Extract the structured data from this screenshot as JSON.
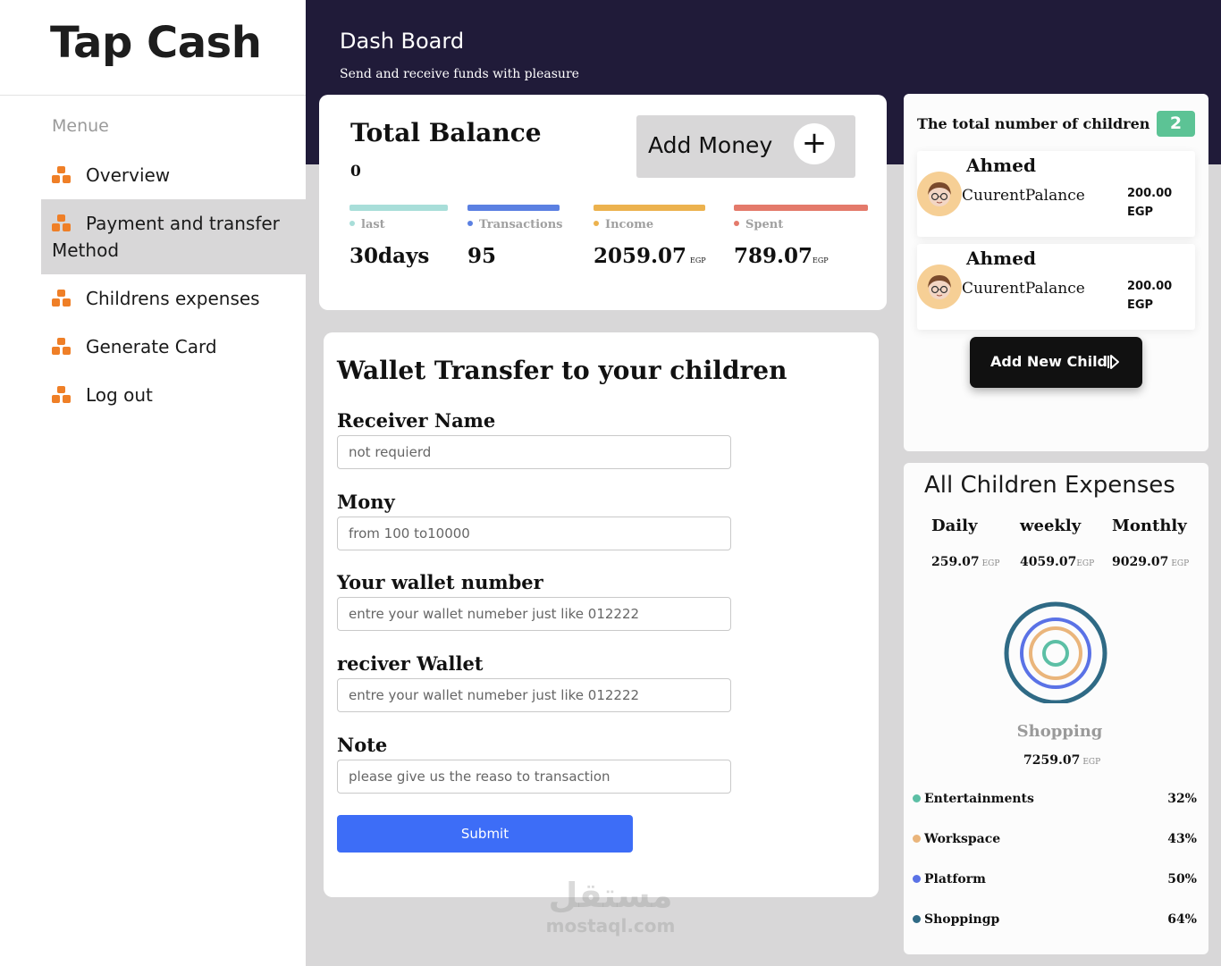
{
  "sidebar": {
    "brand": "Tap Cash",
    "menu_title": "Menue",
    "items": [
      {
        "label": "Overview",
        "icon": "boxes-icon"
      },
      {
        "label": "Payment and transfer Method",
        "icon": "boxes-icon",
        "active": true
      },
      {
        "label": "Childrens expenses",
        "icon": "boxes-icon"
      },
      {
        "label": "Generate Card",
        "icon": "boxes-icon"
      },
      {
        "label": "Log out",
        "icon": "boxes-icon"
      }
    ]
  },
  "header": {
    "title": "Dash Board",
    "subtitle": "Send and receive funds with pleasure"
  },
  "balance": {
    "title": "Total Balance",
    "value": "0",
    "add_money_label": "Add Money",
    "add_money_icon": "plus-icon",
    "stats": [
      {
        "label": "last",
        "value": "30days",
        "unit": "",
        "color": "#a8ded9"
      },
      {
        "label": "Transactions",
        "value": "95",
        "unit": "",
        "color": "#5b80e2"
      },
      {
        "label": "Income",
        "value": "2059.07",
        "unit": "EGP",
        "color": "#ecb24e"
      },
      {
        "label": "Spent",
        "value": "789.07",
        "unit": "EGP",
        "color": "#e47a6b"
      }
    ]
  },
  "transfer": {
    "title": "Wallet Transfer to your children",
    "fields": [
      {
        "label": "Receiver Name",
        "placeholder": "not requierd"
      },
      {
        "label": "Mony",
        "placeholder": "from 100 to10000"
      },
      {
        "label": "Your wallet number",
        "placeholder": "entre your wallet numeber just like 012222"
      },
      {
        "label": "reciver Wallet",
        "placeholder": "entre your wallet numeber just like 012222"
      },
      {
        "label": "Note",
        "placeholder": "please give us the reaso to transaction"
      }
    ],
    "submit_label": "Submit"
  },
  "children": {
    "title": "The total number of children",
    "count": "2",
    "items": [
      {
        "name": "Ahmed",
        "balance_label": "CuurentPalance",
        "amount": "200.00",
        "currency": "EGP"
      },
      {
        "name": "Ahmed",
        "balance_label": "CuurentPalance",
        "amount": "200.00",
        "currency": "EGP"
      }
    ],
    "add_label": "Add New Child",
    "add_icon": "arrow-right-icon"
  },
  "expenses": {
    "title": "All Children Expenses",
    "periods": [
      {
        "label": "Daily",
        "value": "259.07",
        "unit": "EGP"
      },
      {
        "label": "weekly",
        "value": "4059.07",
        "unit": "EGP"
      },
      {
        "label": "Monthly",
        "value": "9029.07",
        "unit": "EGP"
      }
    ],
    "focus": {
      "label": "Shopping",
      "value": "7259.07",
      "unit": "EGP"
    },
    "categories": [
      {
        "label": "Entertainments",
        "percent": "32%",
        "color": "#5cbfa5"
      },
      {
        "label": "Workspace",
        "percent": "43%",
        "color": "#eab57b"
      },
      {
        "label": "Platform",
        "percent": "50%",
        "color": "#5a72e6"
      },
      {
        "label": "Shoppingp",
        "percent": "64%",
        "color": "#2f6a85"
      }
    ]
  },
  "watermark": {
    "arabic": "مستقل",
    "latin": "mostaql.com"
  }
}
